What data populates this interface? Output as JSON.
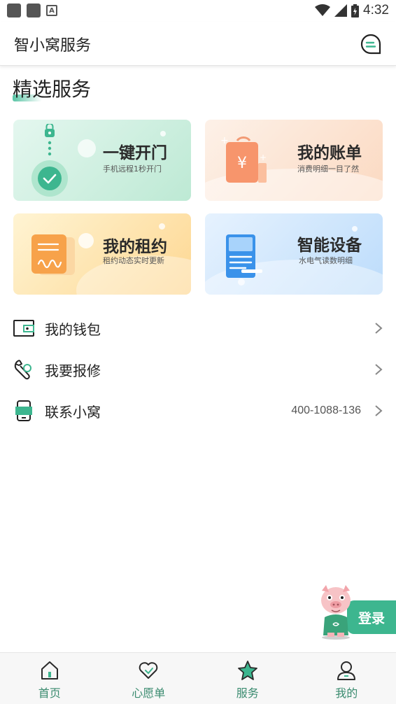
{
  "status_bar": {
    "time": "4:32",
    "notif_letter": "A"
  },
  "header": {
    "title": "智小窝服务"
  },
  "section": {
    "title": "精选服务"
  },
  "cards": {
    "door": {
      "title": "一键开门",
      "subtitle": "手机远程1秒开门"
    },
    "bill": {
      "title": "我的账单",
      "subtitle": "消费明细一目了然",
      "currency": "¥"
    },
    "rent": {
      "title": "我的租约",
      "subtitle": "租约动态实时更新"
    },
    "device": {
      "title": "智能设备",
      "subtitle": "水电气读数明细"
    }
  },
  "list": [
    {
      "label": "我的钱包",
      "icon": "wallet-icon"
    },
    {
      "label": "我要报修",
      "icon": "wrench-icon"
    },
    {
      "label": "联系小窝",
      "icon": "phone-icon",
      "value": "400-1088-136"
    }
  ],
  "login": {
    "label": "登录"
  },
  "tabs": [
    {
      "label": "首页",
      "icon": "home-icon"
    },
    {
      "label": "心愿单",
      "icon": "heart-icon"
    },
    {
      "label": "服务",
      "icon": "star-icon",
      "active": true
    },
    {
      "label": "我的",
      "icon": "user-icon"
    }
  ],
  "colors": {
    "brand": "#3db68f",
    "tab_label": "#3a8b6f"
  }
}
